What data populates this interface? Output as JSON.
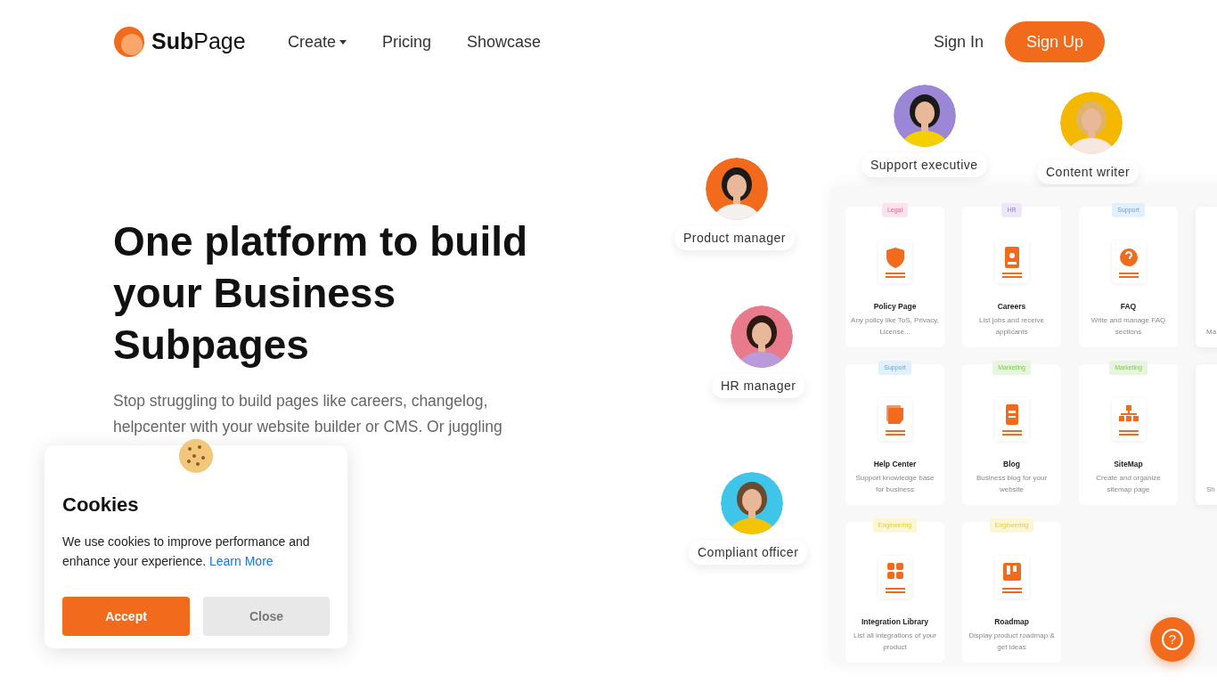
{
  "nav": {
    "logo_bold": "Sub",
    "logo_rest": "Page",
    "items": [
      {
        "label": "Create",
        "dropdown": true
      },
      {
        "label": "Pricing",
        "dropdown": false
      },
      {
        "label": "Showcase",
        "dropdown": false
      }
    ],
    "sign_in": "Sign In",
    "sign_up": "Sign Up"
  },
  "hero": {
    "title": "One platform to build your Business Subpages",
    "subtitle": "Stop struggling to build pages like careers, changelog, helpcenter with your website builder or CMS. Or juggling"
  },
  "personas": [
    {
      "label": "Support executive"
    },
    {
      "label": "Content writer"
    },
    {
      "label": "Product manager"
    },
    {
      "label": "HR manager"
    },
    {
      "label": "Compliant officer"
    }
  ],
  "cards": [
    {
      "kind": "full",
      "tag": "Legal",
      "color": "#fbe3ec",
      "title": "Policy Page",
      "description": "Any policy like ToS, Privacy, License..."
    },
    {
      "kind": "full",
      "tag": "HR",
      "color": "#ebe6f8",
      "title": "Careers",
      "description": "List jobs and receive applicants"
    },
    {
      "kind": "full",
      "tag": "Support",
      "color": "#e1f0fc",
      "title": "FAQ",
      "description": "Write and manage FAQ sections"
    },
    {
      "kind": "partial",
      "description": "Ma"
    },
    {
      "kind": "full",
      "tag": "Support",
      "color": "#e1f0fc",
      "title": "Help Center",
      "description": "Support knowledge base for business"
    },
    {
      "kind": "full",
      "tag": "Marketing",
      "color": "#e7f5df",
      "title": "Blog",
      "description": "Business blog for your website"
    },
    {
      "kind": "full",
      "tag": "Marketing",
      "color": "#e7f5df",
      "title": "SiteMap",
      "description": "Create and organize sitemap page"
    },
    {
      "kind": "partial",
      "description": "Sh"
    },
    {
      "kind": "full",
      "tag": "Engineering",
      "color": "#fdf6d3",
      "title": "Integration Library",
      "description": "List all integrations of your product"
    },
    {
      "kind": "full",
      "tag": "Engineering",
      "color": "#fdf6d3",
      "title": "Roadmap",
      "description": "Display product roadmap & get ideas"
    }
  ],
  "cookie": {
    "title": "Cookies",
    "text": "We use cookies to improve performance and enhance your experience.",
    "link": "Learn More",
    "accept": "Accept",
    "close": "Close"
  },
  "help": {
    "label": "?"
  }
}
